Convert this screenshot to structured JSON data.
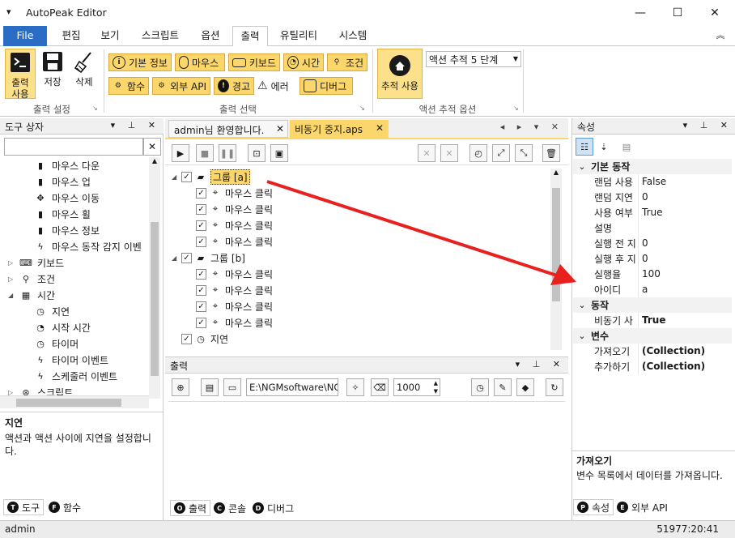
{
  "window": {
    "title": "AutoPeak Editor",
    "menu_glyph": "▾",
    "minimize": "—",
    "maximize": "☐",
    "close": "✕"
  },
  "menu": {
    "tabs": [
      "File",
      "편집",
      "보기",
      "스크립트",
      "옵션",
      "출력",
      "유틸리티",
      "시스템"
    ],
    "collapse": "︽"
  },
  "ribbon": {
    "big": [
      {
        "label": "출력\n사용",
        "icon": "console-icon"
      },
      {
        "label": "저장",
        "icon": "save-icon"
      },
      {
        "label": "삭제",
        "icon": "broom-icon"
      }
    ],
    "group1_label": "출력 설정",
    "row1": [
      "기본 정보",
      "마우스",
      "키보드",
      "시간",
      "조건"
    ],
    "row2": [
      "함수",
      "외부 API",
      "경고",
      "에러",
      "디버그"
    ],
    "group2_label": "출력 선택",
    "track_label": "추적 사용",
    "track_select": "액션 추적 5 단계",
    "group3_label": "액션 추적 옵션"
  },
  "toolbox": {
    "title": "도구 상자",
    "search_placeholder": "",
    "items": [
      {
        "label": "마우스 다운",
        "indent": 2,
        "icon": "mouse-icon"
      },
      {
        "label": "마우스 업",
        "indent": 2,
        "icon": "mouse-icon"
      },
      {
        "label": "마우스 이동",
        "indent": 2,
        "icon": "move-icon"
      },
      {
        "label": "마우스 휠",
        "indent": 2,
        "icon": "mouse-icon"
      },
      {
        "label": "마우스 정보",
        "indent": 2,
        "icon": "mouse-icon"
      },
      {
        "label": "마우스 동작 감지 이벤",
        "indent": 2,
        "icon": "bolt-icon"
      },
      {
        "label": "키보드",
        "indent": 1,
        "icon": "keyboard-icon",
        "expander": "▷"
      },
      {
        "label": "조건",
        "indent": 1,
        "icon": "condition-icon",
        "expander": "▷"
      },
      {
        "label": "시간",
        "indent": 1,
        "icon": "calendar-icon",
        "expander": "◢"
      },
      {
        "label": "지연",
        "indent": 2,
        "icon": "timer-icon"
      },
      {
        "label": "시작 시간",
        "indent": 2,
        "icon": "clock-icon"
      },
      {
        "label": "타이머",
        "indent": 2,
        "icon": "timer-icon"
      },
      {
        "label": "타이머 이벤트",
        "indent": 2,
        "icon": "bolt-icon"
      },
      {
        "label": "스케줄러 이벤트",
        "indent": 2,
        "icon": "bolt-icon"
      },
      {
        "label": "스크립트",
        "indent": 1,
        "icon": "script-icon",
        "expander": "▷"
      }
    ],
    "desc_title": "지연",
    "desc_text": "액션과 액션 사이에 지연을 설정합니다.",
    "tabs": [
      {
        "badge": "T",
        "label": "도구"
      },
      {
        "badge": "F",
        "label": "함수"
      }
    ]
  },
  "doc": {
    "tabs": [
      "admin님 환영합니다.",
      "비동기 중지.aps"
    ],
    "tree": [
      {
        "label": "그룹 [a]",
        "level": 0,
        "group": true,
        "selected": true
      },
      {
        "label": "마우스 클릭",
        "level": 1
      },
      {
        "label": "마우스 클릭",
        "level": 1
      },
      {
        "label": "마우스 클릭",
        "level": 1
      },
      {
        "label": "마우스 클릭",
        "level": 1
      },
      {
        "label": "그룹 [b]",
        "level": 0,
        "group": true
      },
      {
        "label": "마우스 클릭",
        "level": 1
      },
      {
        "label": "마우스 클릭",
        "level": 1
      },
      {
        "label": "마우스 클릭",
        "level": 1
      },
      {
        "label": "마우스 클릭",
        "level": 1
      },
      {
        "label": "지연",
        "level": 0
      }
    ]
  },
  "output": {
    "title": "출력",
    "path": "E:\\NGMsoftware\\NG",
    "lines": "1000",
    "tabs": [
      {
        "badge": "O",
        "label": "출력"
      },
      {
        "badge": "C",
        "label": "콘솔"
      },
      {
        "badge": "D",
        "label": "디버그"
      }
    ]
  },
  "props": {
    "title": "속성",
    "sections": [
      {
        "name": "기본 동작",
        "rows": [
          [
            "랜덤 사용",
            "False"
          ],
          [
            "랜덤 지연",
            "0"
          ],
          [
            "사용 여부",
            "True"
          ],
          [
            "설명",
            ""
          ],
          [
            "실행 전 지",
            "0"
          ],
          [
            "실행 후 지",
            "0"
          ],
          [
            "실행율",
            "100"
          ],
          [
            "아이디",
            "a"
          ]
        ]
      },
      {
        "name": "동작",
        "rows": [
          [
            "비동기 사",
            "True"
          ]
        ]
      },
      {
        "name": "변수",
        "rows": [
          [
            "가져오기",
            "(Collection)"
          ],
          [
            "추가하기",
            "(Collection)"
          ]
        ]
      }
    ],
    "desc_title": "가져오기",
    "desc_text": "변수 목록에서 데이터를 가져옵니다.",
    "tabs": [
      {
        "badge": "P",
        "label": "속성"
      },
      {
        "badge": "E",
        "label": "외부 API"
      }
    ]
  },
  "status": {
    "user": "admin",
    "time": "51977:20:41"
  },
  "colors": {
    "accent": "#2b6cc4",
    "ribbon_btn": "#fbd66a",
    "arrow": "#e8201e"
  }
}
